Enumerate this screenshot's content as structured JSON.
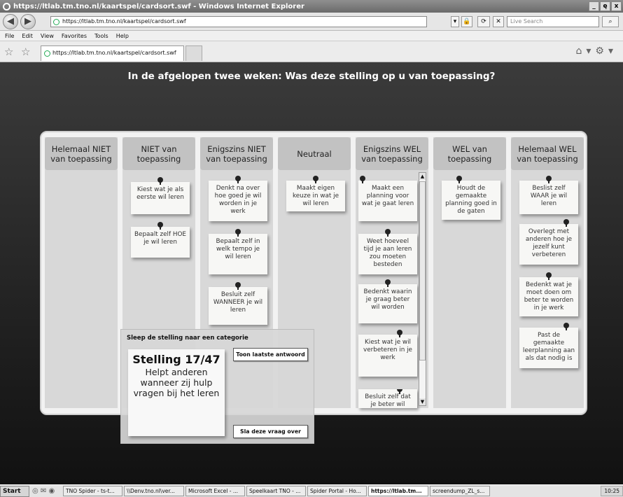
{
  "window": {
    "title": "https://ltlab.tm.tno.nl/kaartspel/cardsort.swf - Windows Internet Explorer",
    "minimize": "_",
    "restore": "ę",
    "close": "x"
  },
  "toolbar": {
    "back": "◀",
    "forward": "▶",
    "address": "https://ltlab.tm.tno.nl/kaartspel/cardsort.swf",
    "search_placeholder": "Live Search",
    "search_icon": "magnifier-icon"
  },
  "menu": [
    "File",
    "Edit",
    "View",
    "Favorites",
    "Tools",
    "Help"
  ],
  "tab": {
    "label": "https://ltlab.tm.tno.nl/kaartspel/cardsort.swf"
  },
  "game": {
    "question": "In de afgelopen twee weken: Was deze stelling op u van toepassing?",
    "columns": [
      {
        "header": "Helemaal NIET van toepassing",
        "cards": []
      },
      {
        "header": "NIET van toepassing",
        "cards": [
          "Kiest wat je als eerste wil leren",
          "Bepaalt zelf HOE je wil leren"
        ]
      },
      {
        "header": "Enigszins NIET van toepassing",
        "cards": [
          "Denkt na over hoe goed je wil worden in je werk",
          "Bepaalt zelf in welk tempo je wil leren",
          "Besluit zelf WANNEER je wil leren"
        ]
      },
      {
        "header": "Neutraal",
        "cards": [
          "Maakt eigen keuze in wat je wil leren"
        ]
      },
      {
        "header": "Enigszins WEL van toepassing",
        "cards": [
          "Maakt een planning voor wat je gaat leren",
          "Weet hoeveel tijd je aan leren zou moeten besteden",
          "Bedenkt waarin je graag beter wil worden",
          "Kiest wat je wil verbeteren in je werk",
          "Besluit zelf dat je beter wil worden"
        ]
      },
      {
        "header": "WEL van toepassing",
        "cards": [
          "Houdt de gemaakte planning goed in de gaten"
        ]
      },
      {
        "header": "Helemaal WEL van toepassing",
        "cards": [
          "Beslist zelf WAAR je wil leren",
          "Overlegt met anderen hoe je jezelf kunt verbeteren",
          "Bedenkt wat je moet doen om beter te worden in je werk",
          "Past de gemaakte leerplanning aan als dat nodig is"
        ]
      }
    ],
    "drag_panel": {
      "title": "Sleep de stelling naar een categorie",
      "card_number": "Stelling 17/47",
      "card_text": "Helpt anderen wanneer zij hulp vragen bij het leren",
      "show_last": "Toon laatste antwoord",
      "skip": "Sla deze vraag over"
    }
  },
  "taskbar": {
    "start": "Start",
    "tasks": [
      "TNO Spider - ts-t...",
      "\\\\Denv.tno.nl\\ver...",
      "Microsoft Excel - ...",
      "Speelkaart TNO - ...",
      "Spider Portal - Ho...",
      "https://ltlab.tm...",
      "screendump_ZL_s..."
    ],
    "active_task": 5,
    "clock": "10:25"
  }
}
